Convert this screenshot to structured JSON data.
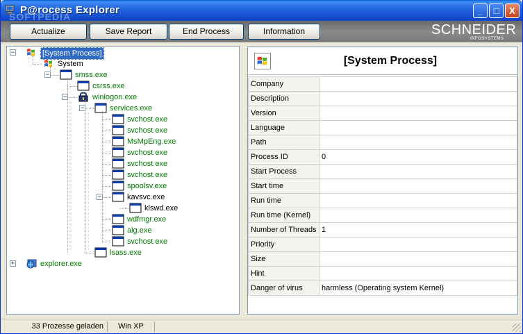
{
  "window": {
    "title": "P@rocess Explorer",
    "watermark": "SOFTPEDIA",
    "controls": {
      "minimize": "_",
      "maximize": "□",
      "close": "X"
    }
  },
  "toolbar": {
    "buttons": [
      "Actualize",
      "Save Report",
      "End Process",
      "Information"
    ],
    "brand": "SCHNEIDER",
    "brand_sub": "INFOSYSTEMS"
  },
  "tree": {
    "nodes": [
      {
        "label": "[System Process]",
        "icon": "windows-flag-icon",
        "selected": true
      },
      {
        "label": "System",
        "icon": "windows-flag-icon"
      },
      {
        "label": "smss.exe",
        "icon": "window-app-icon"
      },
      {
        "label": "csrss.exe",
        "icon": "window-app-icon"
      },
      {
        "label": "winlogon.exe",
        "icon": "lock-app-icon"
      },
      {
        "label": "services.exe",
        "icon": "window-app-icon"
      },
      {
        "label": "svchost.exe",
        "icon": "window-app-icon"
      },
      {
        "label": "svchost.exe",
        "icon": "window-app-icon"
      },
      {
        "label": "MsMpEng.exe",
        "icon": "window-app-icon"
      },
      {
        "label": "svchost.exe",
        "icon": "window-app-icon"
      },
      {
        "label": "svchost.exe",
        "icon": "window-app-icon"
      },
      {
        "label": "svchost.exe",
        "icon": "window-app-icon"
      },
      {
        "label": "spoolsv.exe",
        "icon": "window-app-icon"
      },
      {
        "label": "kavsvc.exe",
        "icon": "window-app-icon"
      },
      {
        "label": "klswd.exe",
        "icon": "window-app-icon"
      },
      {
        "label": "wdfmgr.exe",
        "icon": "window-app-icon"
      },
      {
        "label": "alg.exe",
        "icon": "window-app-icon"
      },
      {
        "label": "svchost.exe",
        "icon": "window-app-icon"
      },
      {
        "label": "lsass.exe",
        "icon": "window-app-icon"
      },
      {
        "label": "explorer.exe",
        "icon": "explorer-globe-icon"
      }
    ]
  },
  "details": {
    "title": "[System Process]",
    "rows": [
      {
        "key": "Company",
        "value": ""
      },
      {
        "key": "Description",
        "value": ""
      },
      {
        "key": "Version",
        "value": ""
      },
      {
        "key": "Language",
        "value": ""
      },
      {
        "key": "Path",
        "value": ""
      },
      {
        "key": "Process ID",
        "value": "0"
      },
      {
        "key": "Start Process",
        "value": ""
      },
      {
        "key": "Start time",
        "value": ""
      },
      {
        "key": "Run time",
        "value": ""
      },
      {
        "key": "Run time (Kernel)",
        "value": ""
      },
      {
        "key": "Number of Threads",
        "value": "1"
      },
      {
        "key": "Priority",
        "value": ""
      },
      {
        "key": "Size",
        "value": ""
      },
      {
        "key": "Hint",
        "value": ""
      },
      {
        "key": "Danger of virus",
        "value": "harmless (Operating system Kernel)"
      }
    ]
  },
  "status": {
    "count": "33 Prozesse geladen",
    "os": "Win XP"
  },
  "colors": {
    "title_blue": "#0a5fd8",
    "process_green": "#008000",
    "selection": "#316ac5"
  }
}
